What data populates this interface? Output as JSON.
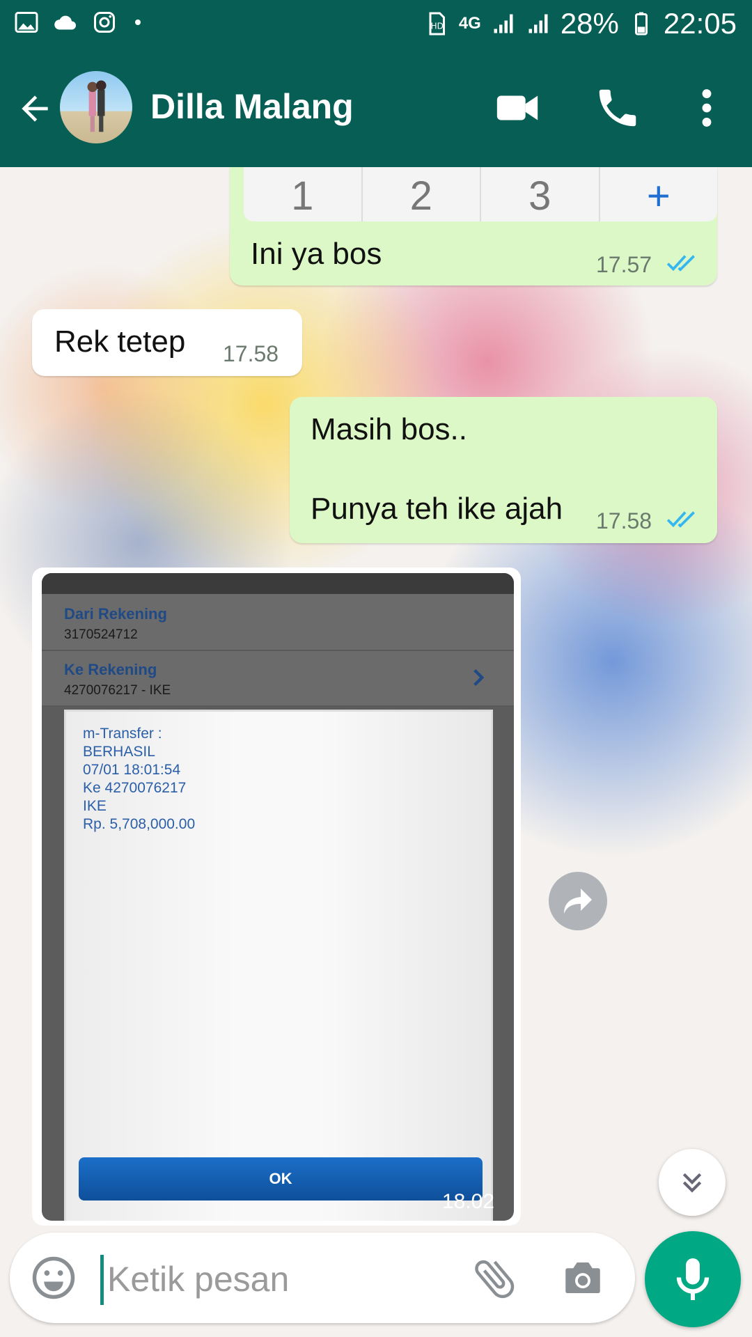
{
  "status_bar": {
    "network": "4G",
    "battery": "28%",
    "time": "22:05"
  },
  "header": {
    "contact_name": "Dilla Malang"
  },
  "messages": [
    {
      "direction": "out",
      "text": "Ini ya bos",
      "time": "17.57",
      "status": "read",
      "partial_keypad": [
        "1",
        "2",
        "3",
        "+"
      ]
    },
    {
      "direction": "in",
      "text": "Rek tetep",
      "time": "17.58"
    },
    {
      "direction": "out",
      "lines": [
        "Masih bos..",
        "Punya teh ike ajah"
      ],
      "time": "17.58",
      "status": "read"
    },
    {
      "direction": "in",
      "type": "image",
      "time": "18.02",
      "image_content": {
        "from_label": "Dari Rekening",
        "from_value": "3170524712",
        "to_label": "Ke Rekening",
        "to_value": "4270076217 - IKE",
        "dialog_lines": [
          "m-Transfer :",
          "BERHASIL",
          "07/01 18:01:54",
          "Ke 4270076217",
          "IKE",
          "Rp. 5,708,000.00"
        ],
        "ok_button": "OK"
      }
    }
  ],
  "input": {
    "placeholder": "Ketik pesan"
  },
  "colors": {
    "header": "#075e54",
    "outgoing_bubble": "#dcf8c6",
    "incoming_bubble": "#ffffff",
    "read_ticks": "#34b7f1",
    "mic_button": "#00a884"
  }
}
